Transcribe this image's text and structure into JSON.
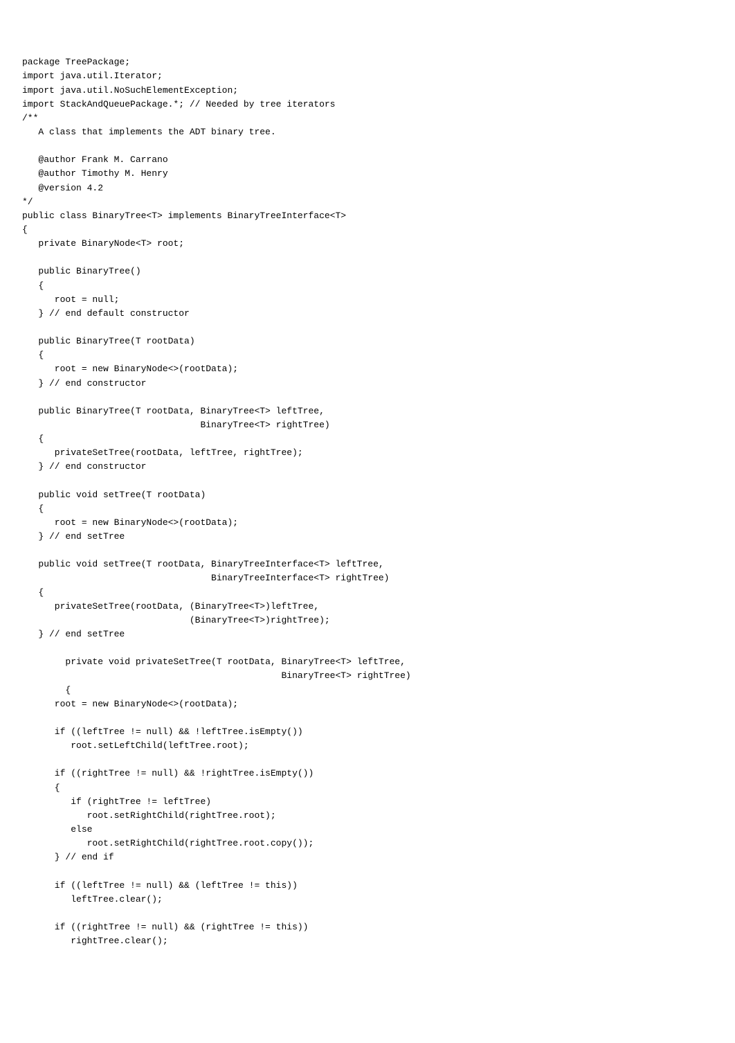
{
  "code": "package TreePackage;\nimport java.util.Iterator;\nimport java.util.NoSuchElementException;\nimport StackAndQueuePackage.*; // Needed by tree iterators\n/**\n   A class that implements the ADT binary tree.\n   \n   @author Frank M. Carrano\n   @author Timothy M. Henry\n   @version 4.2\n*/\npublic class BinaryTree<T> implements BinaryTreeInterface<T>\n{\n   private BinaryNode<T> root;\n\n   public BinaryTree()\n   {\n      root = null;\n   } // end default constructor\n\n   public BinaryTree(T rootData)\n   {\n      root = new BinaryNode<>(rootData);\n   } // end constructor\n\n   public BinaryTree(T rootData, BinaryTree<T> leftTree,\n                                 BinaryTree<T> rightTree)\n   {\n      privateSetTree(rootData, leftTree, rightTree);\n   } // end constructor\n\n   public void setTree(T rootData)\n   {\n      root = new BinaryNode<>(rootData);\n   } // end setTree\n\n   public void setTree(T rootData, BinaryTreeInterface<T> leftTree,\n                                   BinaryTreeInterface<T> rightTree)\n   {\n      privateSetTree(rootData, (BinaryTree<T>)leftTree, \n                               (BinaryTree<T>)rightTree);\n   } // end setTree\n\n\tprivate void privateSetTree(T rootData, BinaryTree<T> leftTree, \n\t                                        BinaryTree<T> rightTree)\n\t{\n      root = new BinaryNode<>(rootData);\n\n      if ((leftTree != null) && !leftTree.isEmpty())\n         root.setLeftChild(leftTree.root);\n\n      if ((rightTree != null) && !rightTree.isEmpty())\n      {\n         if (rightTree != leftTree)\n            root.setRightChild(rightTree.root);\n         else\n            root.setRightChild(rightTree.root.copy());\n      } // end if\n\n      if ((leftTree != null) && (leftTree != this))\n         leftTree.clear();\n\n      if ((rightTree != null) && (rightTree != this))\n         rightTree.clear();"
}
